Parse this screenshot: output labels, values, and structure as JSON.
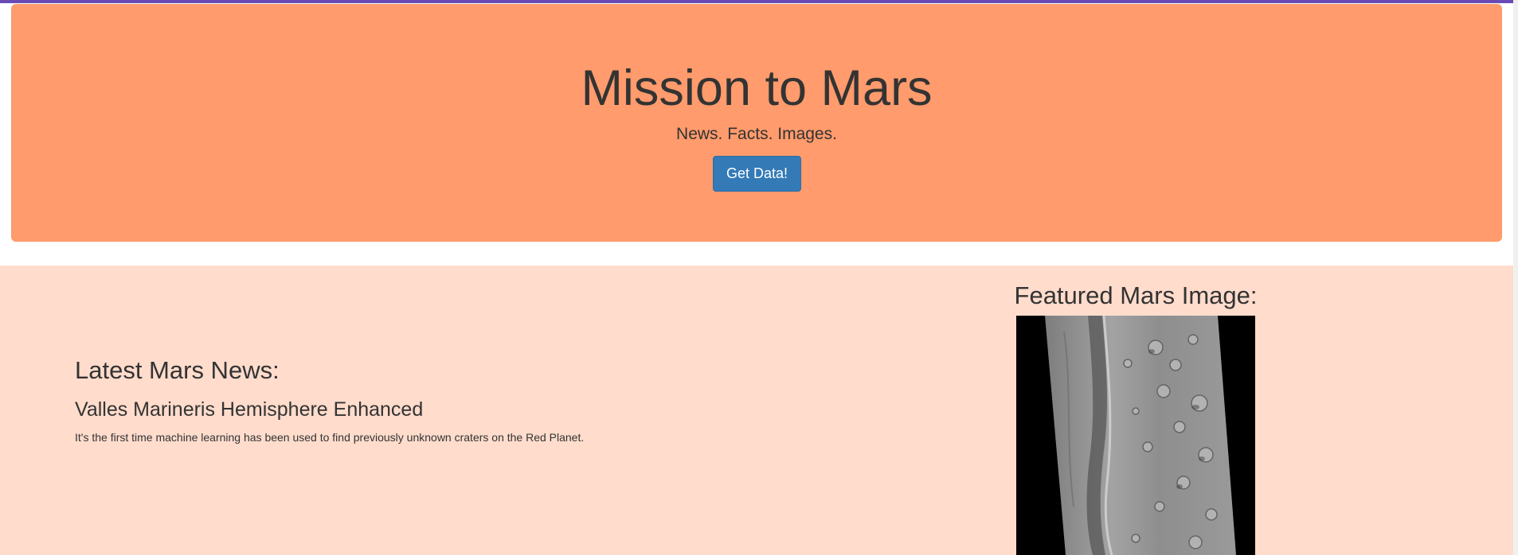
{
  "hero": {
    "title": "Mission to Mars",
    "tagline": "News. Facts. Images.",
    "button_label": "Get Data!"
  },
  "news": {
    "section_heading": "Latest Mars News:",
    "title": "Valles Marineris Hemisphere Enhanced",
    "teaser": "It's the first time machine learning has been used to find previously unknown craters on the Red Planet."
  },
  "featured": {
    "section_heading": "Featured Mars Image:",
    "image_icon": "mars-surface-image"
  },
  "colors": {
    "accent_bar": "#6a4bb5",
    "jumbotron_bg": "#ff9b6c",
    "content_bg": "#ffdccc",
    "button_bg": "#337ab7",
    "text": "#333333"
  }
}
